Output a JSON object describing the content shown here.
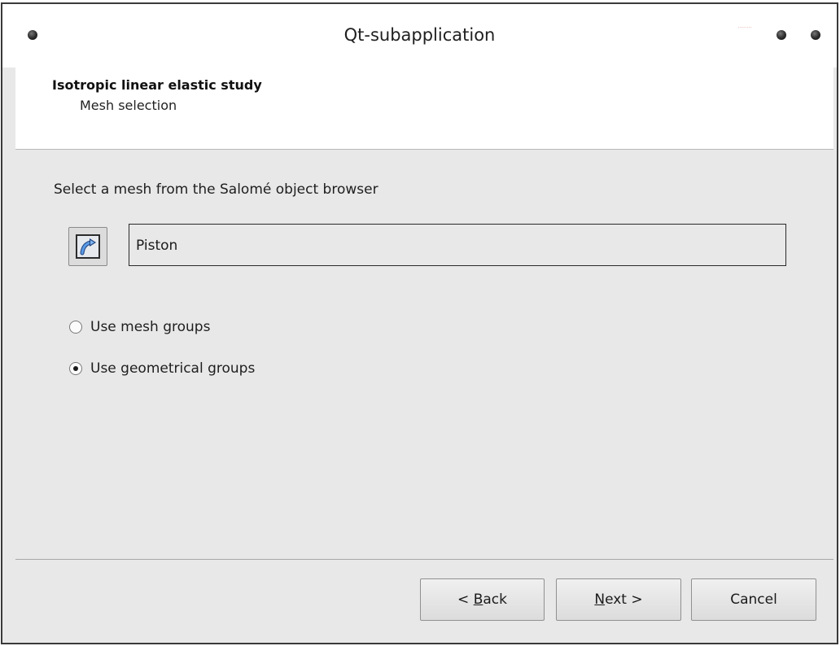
{
  "window": {
    "title": "Qt-subapplication",
    "tray_label": "........"
  },
  "wizard": {
    "title": "Isotropic linear elastic study",
    "subtitle": "Mesh selection"
  },
  "page": {
    "instruction": "Select a mesh from the Salomé object browser",
    "select_button_icon": "select-arrow-icon",
    "mesh_name": "Piston",
    "group_options": [
      {
        "label": "Use mesh groups",
        "checked": false
      },
      {
        "label": "Use geometrical groups",
        "checked": true
      }
    ]
  },
  "buttons": {
    "back_prefix": "< ",
    "back_mnemonic": "B",
    "back_rest": "ack",
    "next_mnemonic": "N",
    "next_rest": "ext >",
    "cancel": "Cancel"
  },
  "colors": {
    "window_bg": "#e8e8e8",
    "header_bg": "#ffffff",
    "icon_blue": "#3a7bd5"
  }
}
